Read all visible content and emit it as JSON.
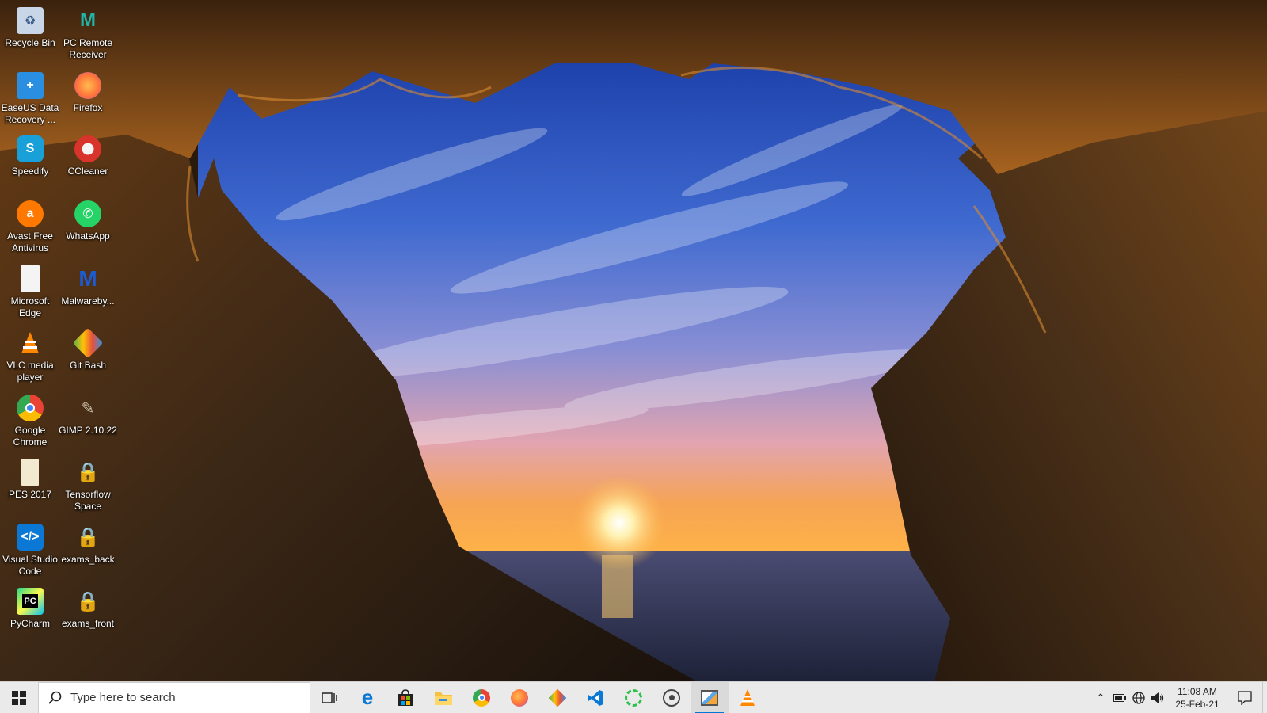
{
  "desktop": {
    "icons": [
      {
        "label": "Recycle Bin",
        "icon": "recycle-bin-icon",
        "color": "#9fb8d8"
      },
      {
        "label": "PC Remote Receiver",
        "icon": "pc-remote-icon",
        "color": "#1fb5a8"
      },
      {
        "label": "EaseUS Data Recovery ...",
        "icon": "easeus-icon",
        "color": "#2a8fe0"
      },
      {
        "label": "Firefox",
        "icon": "firefox-icon",
        "color": "#ff7139"
      },
      {
        "label": "Speedify",
        "icon": "speedify-icon",
        "color": "#1aa0d8"
      },
      {
        "label": "CCleaner",
        "icon": "ccleaner-icon",
        "color": "#d9342b"
      },
      {
        "label": "Avast Free Antivirus",
        "icon": "avast-icon",
        "color": "#ff7800"
      },
      {
        "label": "WhatsApp",
        "icon": "whatsapp-icon",
        "color": "#25d366"
      },
      {
        "label": "Microsoft Edge",
        "icon": "file-icon",
        "color": "#f4f4f4"
      },
      {
        "label": "Malwareby...",
        "icon": "malwarebytes-icon",
        "color": "#1b5bd6"
      },
      {
        "label": "VLC media player",
        "icon": "vlc-icon",
        "color": "#ff8800"
      },
      {
        "label": "Git Bash",
        "icon": "git-bash-icon",
        "color": "#e8503a"
      },
      {
        "label": "Google Chrome",
        "icon": "chrome-icon",
        "color": "#4285f4"
      },
      {
        "label": "GIMP 2.10.22",
        "icon": "gimp-icon",
        "color": "#8b7c6a"
      },
      {
        "label": "PES 2017",
        "icon": "pes-file-icon",
        "color": "#f2ead0"
      },
      {
        "label": "Tensorflow Space",
        "icon": "lock-folder-icon",
        "color": "#e8b92a"
      },
      {
        "label": "Visual Studio Code",
        "icon": "vscode-icon",
        "color": "#0a78d4"
      },
      {
        "label": "exams_back",
        "icon": "lock-folder-icon",
        "color": "#e8b92a"
      },
      {
        "label": "PyCharm",
        "icon": "pycharm-icon",
        "color": "#21d789"
      },
      {
        "label": "exams_front",
        "icon": "lock-folder-icon",
        "color": "#e8b92a"
      }
    ]
  },
  "taskbar": {
    "search_placeholder": "Type here to search",
    "apps": [
      {
        "name": "task-view",
        "icon": "task-view-icon",
        "state": "idle"
      },
      {
        "name": "edge",
        "icon": "edge-icon",
        "state": "idle"
      },
      {
        "name": "store",
        "icon": "store-icon",
        "state": "idle"
      },
      {
        "name": "file-explorer",
        "icon": "folder-icon",
        "state": "idle"
      },
      {
        "name": "chrome",
        "icon": "chrome-icon",
        "state": "idle"
      },
      {
        "name": "firefox",
        "icon": "firefox-icon",
        "state": "idle"
      },
      {
        "name": "git",
        "icon": "git-icon",
        "state": "idle"
      },
      {
        "name": "vscode",
        "icon": "vscode-icon",
        "state": "idle"
      },
      {
        "name": "ring-app",
        "icon": "ring-icon",
        "state": "idle"
      },
      {
        "name": "media-app",
        "icon": "disc-icon",
        "state": "idle"
      },
      {
        "name": "paint",
        "icon": "paint-icon",
        "state": "active"
      },
      {
        "name": "vlc",
        "icon": "vlc-icon",
        "state": "idle"
      }
    ],
    "clock_time": "11:08 AM",
    "clock_date": "25-Feb-21"
  }
}
